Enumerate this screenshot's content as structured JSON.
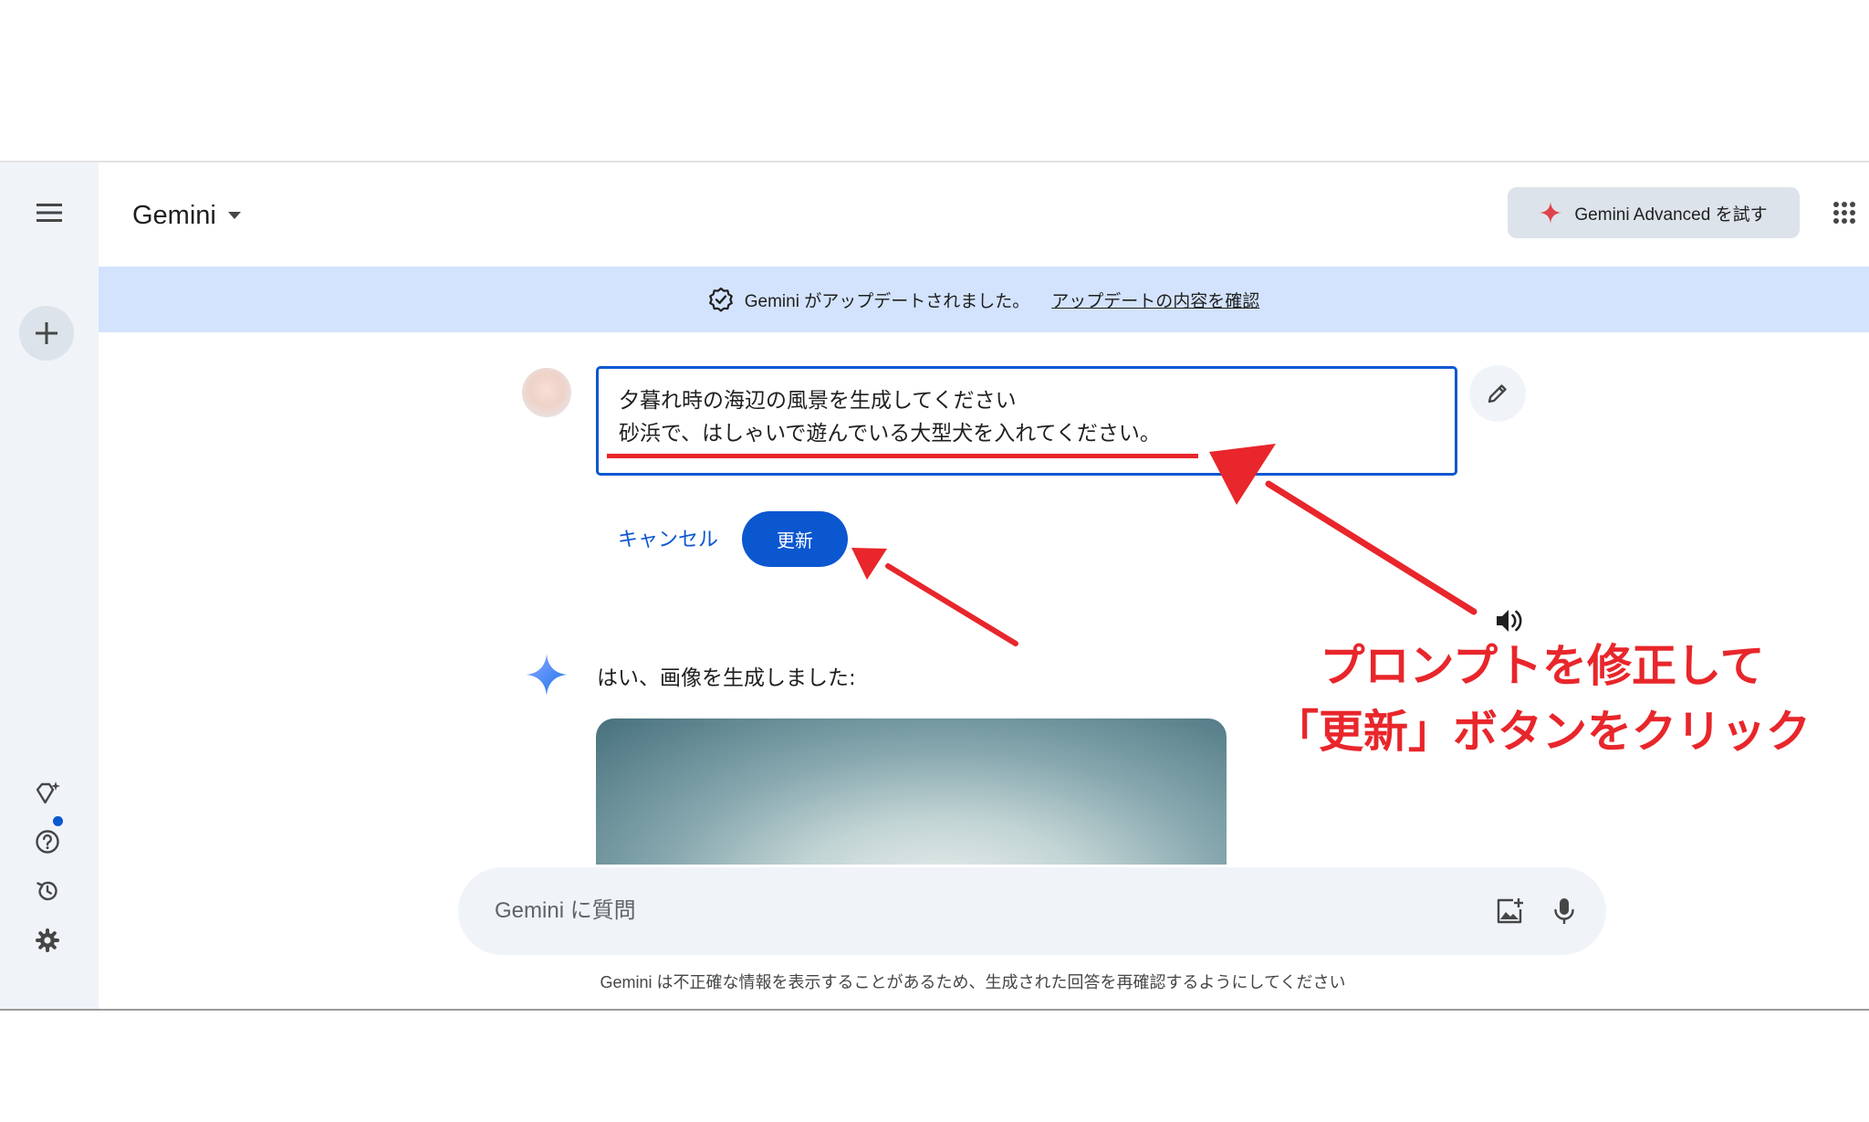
{
  "app": {
    "title": "Gemini"
  },
  "header": {
    "advanced_label": "Gemini Advanced を試す"
  },
  "banner": {
    "message": "Gemini がアップデートされました。",
    "link": "アップデートの内容を確認"
  },
  "edit_prompt": {
    "lines": [
      "夕暮れ時の海辺の風景を生成してください",
      "砂浜で、はしゃいで遊んでいる大型犬を入れてください。"
    ],
    "cancel_label": "キャンセル",
    "update_label": "更新"
  },
  "response": {
    "text": "はい、画像を生成しました:"
  },
  "annotation": {
    "lines": [
      "プロンプトを修正して",
      "「更新」ボタンをクリック"
    ]
  },
  "input": {
    "placeholder": "Gemini に質問"
  },
  "footer": {
    "disclaimer": "Gemini は不正確な情報を表示することがあるため、生成された回答を再確認するようにしてください"
  },
  "icons": {
    "menu": "menu-icon",
    "new_chat": "plus-icon",
    "gem": "gem-icon",
    "help": "help-icon",
    "activity": "history-icon",
    "settings": "gear-icon",
    "apps": "apps-grid-icon",
    "banner": "verified-badge-icon",
    "edit": "pencil-icon",
    "sparkle": "gemini-sparkle-icon",
    "speaker": "speaker-icon",
    "add_image": "add-image-icon",
    "mic": "mic-icon",
    "dropdown": "caret-down-icon",
    "advanced_sparkle": "sparkle-icon"
  },
  "colors": {
    "accent": "#0b57d0",
    "sidebar_bg": "#f0f4f9",
    "banner_bg": "#d3e3fd",
    "annotation_red": "#e8262b",
    "advanced_sparkle": "#e0424a"
  }
}
